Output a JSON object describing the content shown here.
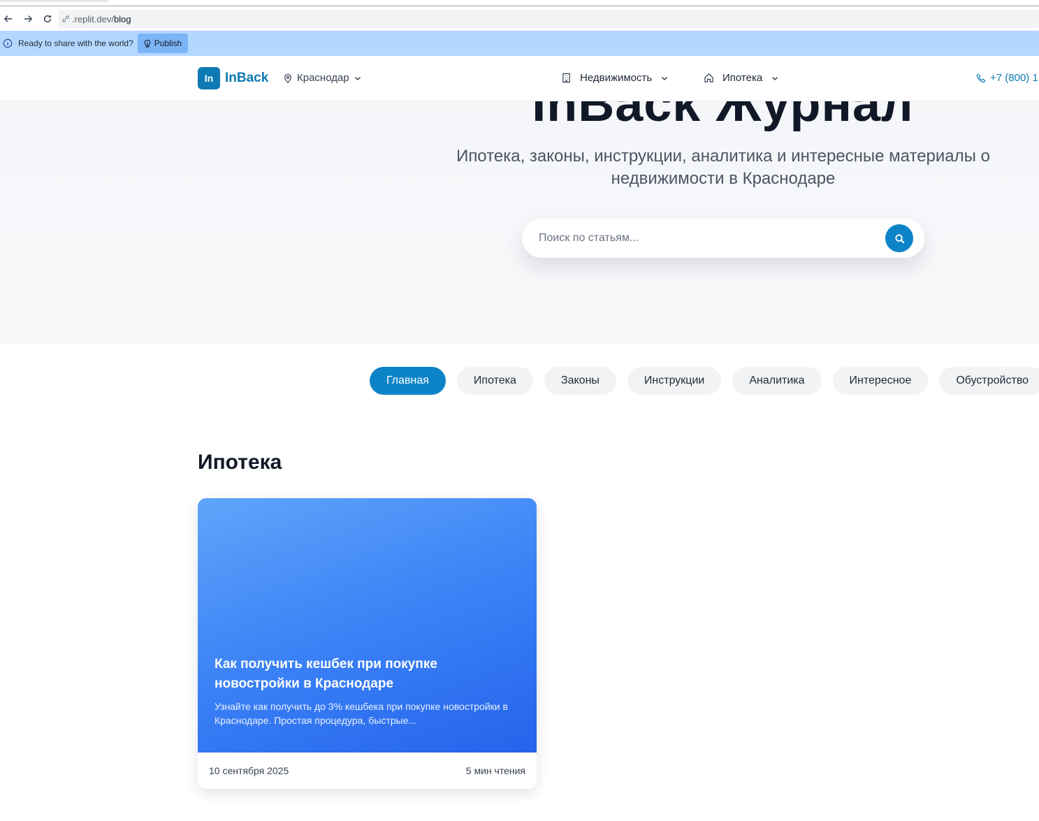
{
  "browser": {
    "url_host": ".replit.dev/",
    "url_path": "blog"
  },
  "banner": {
    "text": "Ready to share with the world?",
    "publish_label": "Publish"
  },
  "header": {
    "logo_badge": "In",
    "logo_text": "InBack",
    "city": "Краснодар",
    "menu": [
      {
        "label": "Недвижимость",
        "icon": "building-icon"
      },
      {
        "label": "Ипотека",
        "icon": "home-icon"
      }
    ],
    "phone": "+7 (800) 1"
  },
  "hero": {
    "title": "InBack Журнал",
    "subtitle": "Ипотека, законы, инструкции, аналитика и интересные материалы о недвижимости в Краснодаре",
    "search_placeholder": "Поиск по статьям..."
  },
  "categories": [
    "Главная",
    "Ипотека",
    "Законы",
    "Инструкции",
    "Аналитика",
    "Интересное",
    "Обустройство"
  ],
  "active_category": "Главная",
  "colors": {
    "accent": "#0e84c8",
    "banner": "#b3d8ff",
    "card_gradient_start": "#60a5fa",
    "card_gradient_end": "#2563eb"
  },
  "section": {
    "title": "Ипотека",
    "articles": [
      {
        "title": "Как получить кешбек при покупке новостройки в Краснодаре",
        "excerpt": "Узнайте как получить до 3% кешбека при покупке новостройки в Краснодаре. Простая процедура, быстрые...",
        "date": "10 сентября 2025",
        "read_time": "5 мин чтения"
      }
    ]
  }
}
